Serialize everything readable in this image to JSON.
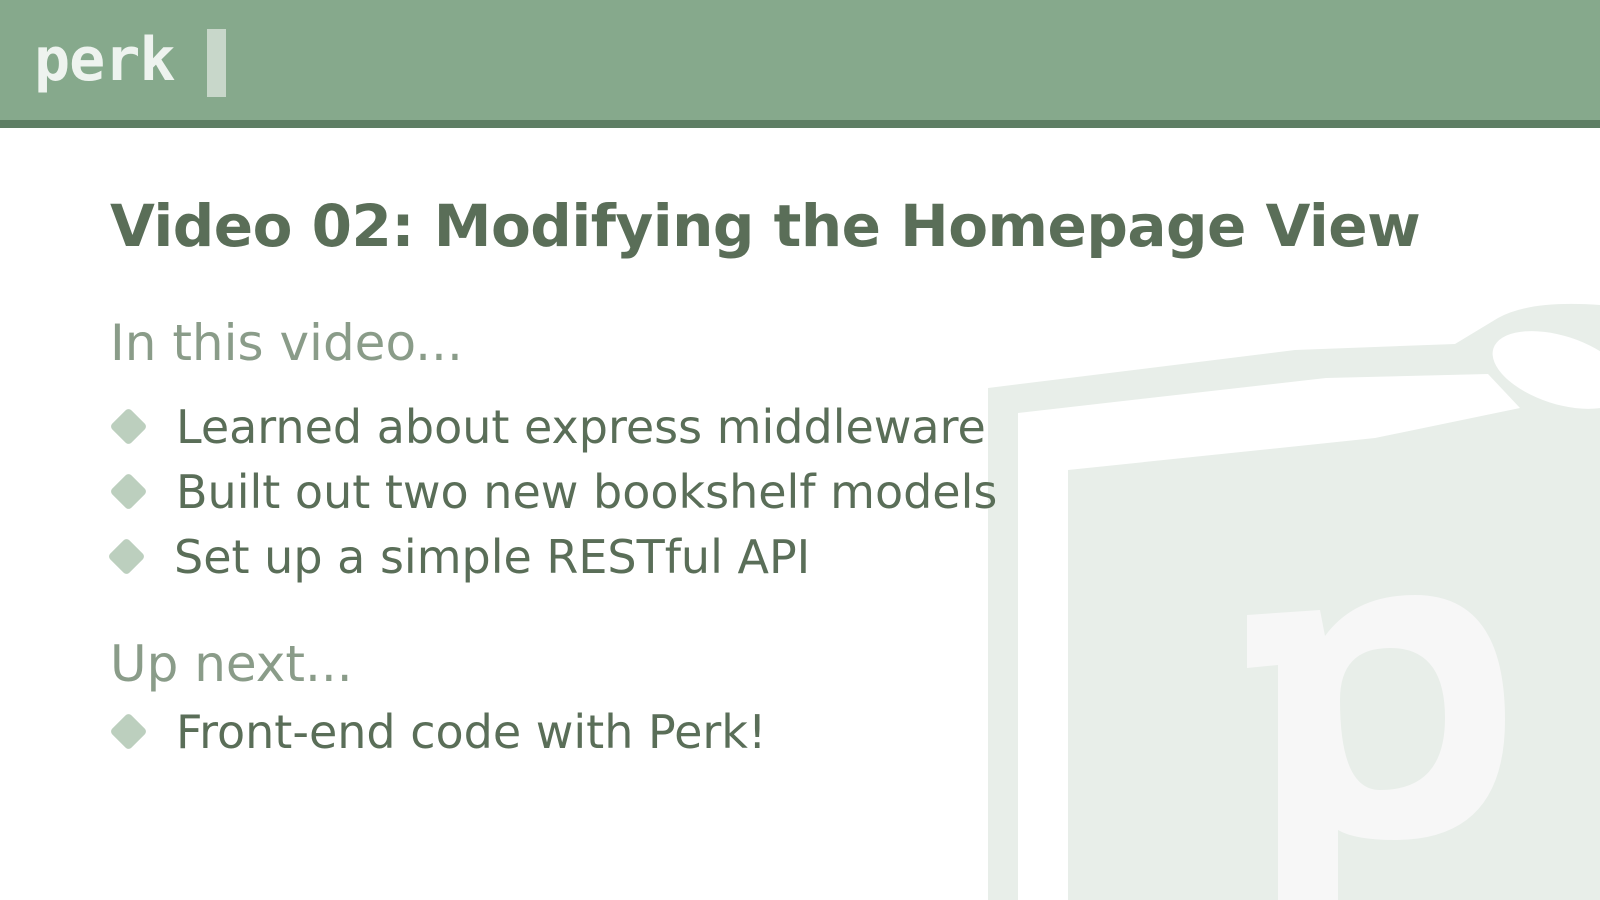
{
  "header": {
    "logo_text": "perk"
  },
  "slide": {
    "title": "Video 02: Modifying the Homepage View",
    "sections": [
      {
        "heading": "In this video...",
        "items": [
          "Learned about express middleware",
          "Built out two new bookshelf models",
          "Set up a simple RESTful API"
        ]
      },
      {
        "heading": "Up next...",
        "items": [
          "Front-end code with Perk!"
        ]
      }
    ]
  },
  "watermark": {
    "icon": "perk-book-logo-icon"
  },
  "colors": {
    "header_bg": "#86a98c",
    "header_border": "#5e7e64",
    "title": "#5a6e58",
    "section_heading": "#8a9c89",
    "bullet": "#bccfbe",
    "watermark": "#e8eee9"
  }
}
